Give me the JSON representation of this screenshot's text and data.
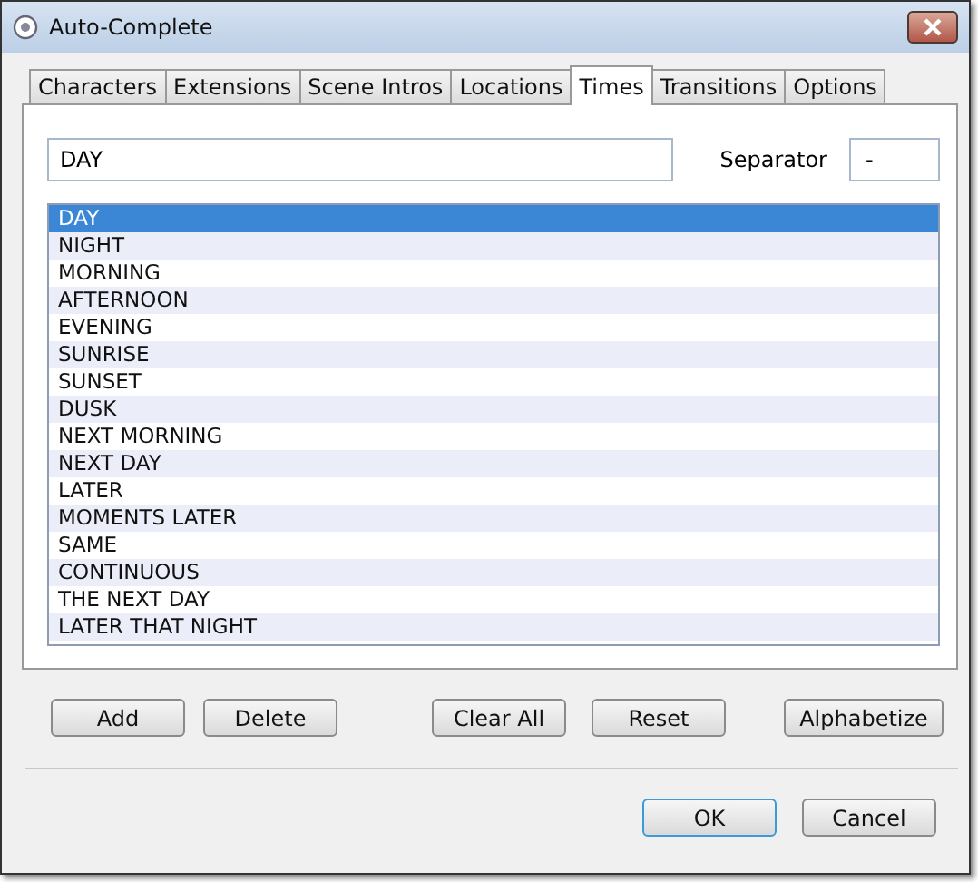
{
  "window": {
    "title": "Auto-Complete"
  },
  "tabs": [
    {
      "label": "Characters",
      "selected": false
    },
    {
      "label": "Extensions",
      "selected": false
    },
    {
      "label": "Scene Intros",
      "selected": false
    },
    {
      "label": "Locations",
      "selected": false
    },
    {
      "label": "Times",
      "selected": true
    },
    {
      "label": "Transitions",
      "selected": false
    },
    {
      "label": "Options",
      "selected": false
    }
  ],
  "entry": {
    "value": "DAY"
  },
  "separator": {
    "label": "Separator",
    "value": "-"
  },
  "items": [
    {
      "text": "DAY",
      "selected": true
    },
    {
      "text": "NIGHT",
      "selected": false
    },
    {
      "text": "MORNING",
      "selected": false
    },
    {
      "text": "AFTERNOON",
      "selected": false
    },
    {
      "text": "EVENING",
      "selected": false
    },
    {
      "text": "SUNRISE",
      "selected": false
    },
    {
      "text": "SUNSET",
      "selected": false
    },
    {
      "text": "DUSK",
      "selected": false
    },
    {
      "text": "NEXT MORNING",
      "selected": false
    },
    {
      "text": "NEXT DAY",
      "selected": false
    },
    {
      "text": "LATER",
      "selected": false
    },
    {
      "text": "MOMENTS LATER",
      "selected": false
    },
    {
      "text": "SAME",
      "selected": false
    },
    {
      "text": "CONTINUOUS",
      "selected": false
    },
    {
      "text": "THE NEXT DAY",
      "selected": false
    },
    {
      "text": "LATER THAT NIGHT",
      "selected": false
    }
  ],
  "actions": [
    "Add",
    "Delete",
    "Clear All",
    "Reset",
    "Alphabetize"
  ],
  "dialog_buttons": [
    "OK",
    "Cancel"
  ]
}
